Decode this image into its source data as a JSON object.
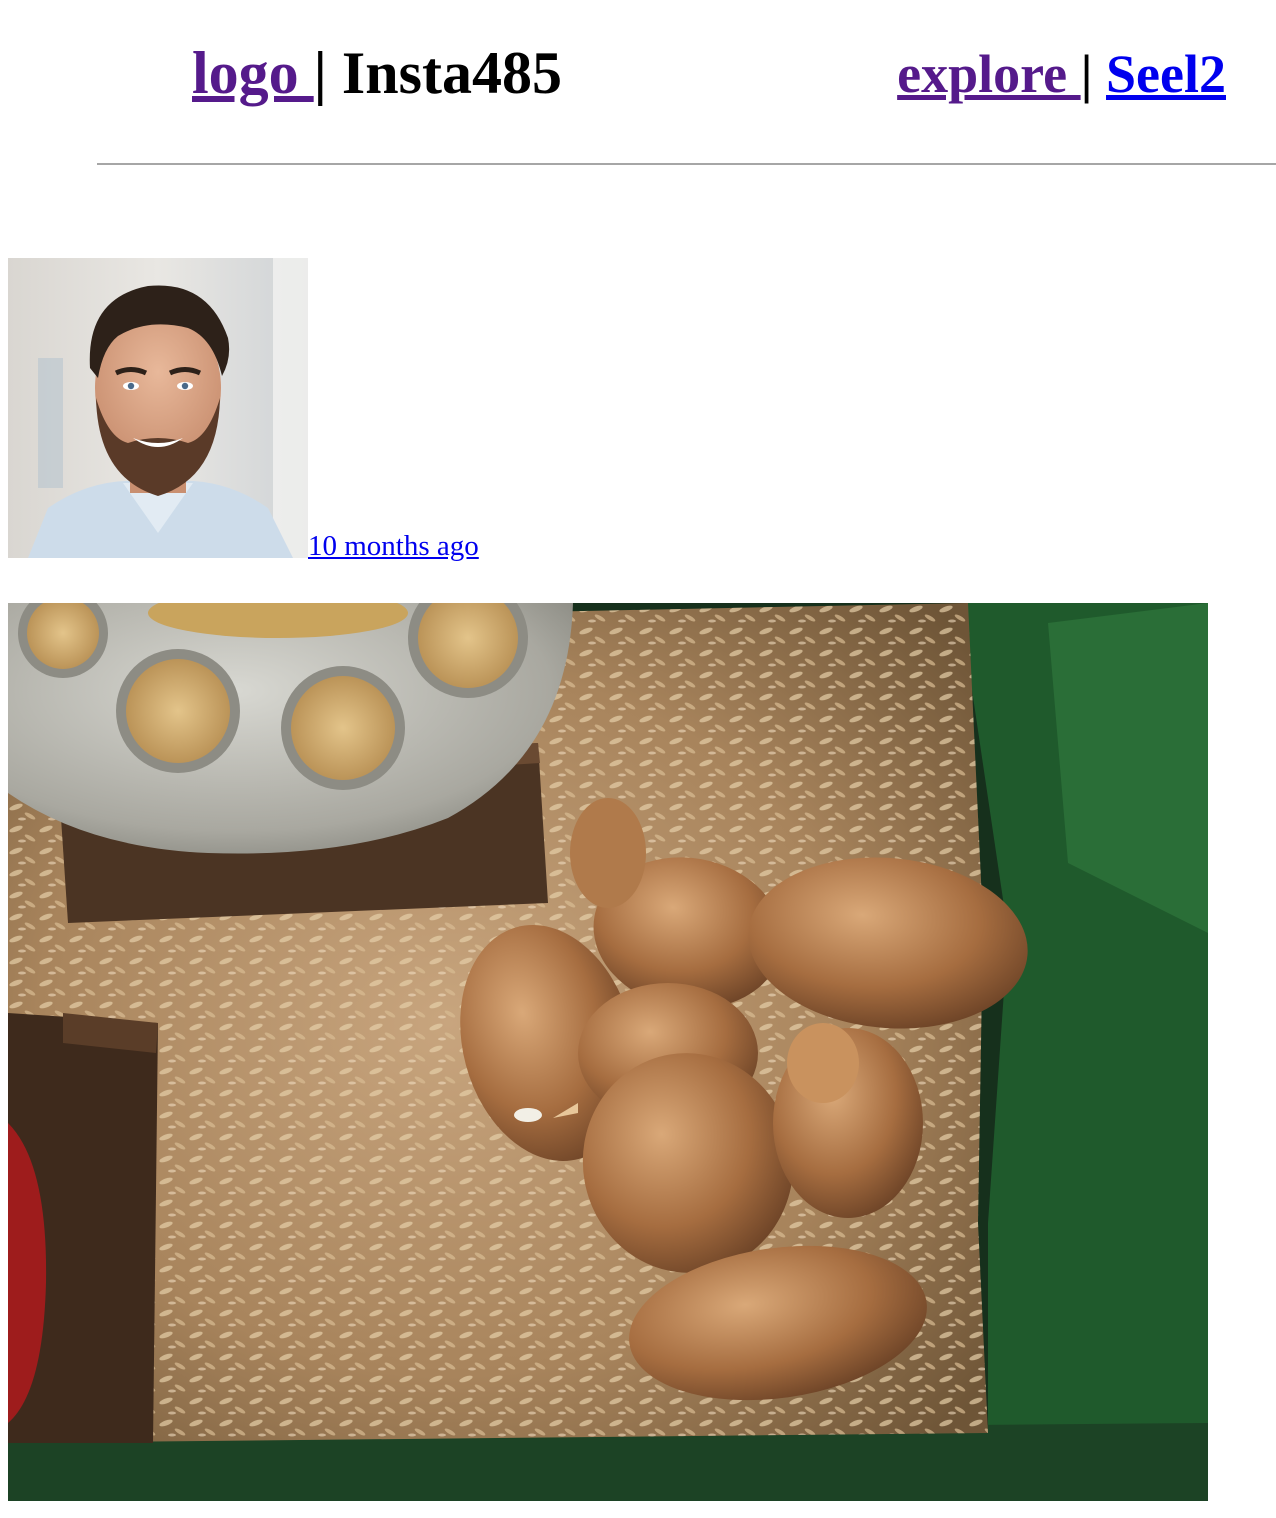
{
  "header": {
    "logo_label": "logo ",
    "separator": "|",
    "app_name": "Insta485",
    "explore_label": "explore ",
    "user_label": "Seel2"
  },
  "post": {
    "owner_avatar_icon": "avatar-photo",
    "timestamp": "10 months ago",
    "image_icon": "post-photo-chicks-in-brooder"
  },
  "colors": {
    "visited_link": "#551a8b",
    "link": "#0000ee",
    "divider": "#a6a6a6"
  }
}
